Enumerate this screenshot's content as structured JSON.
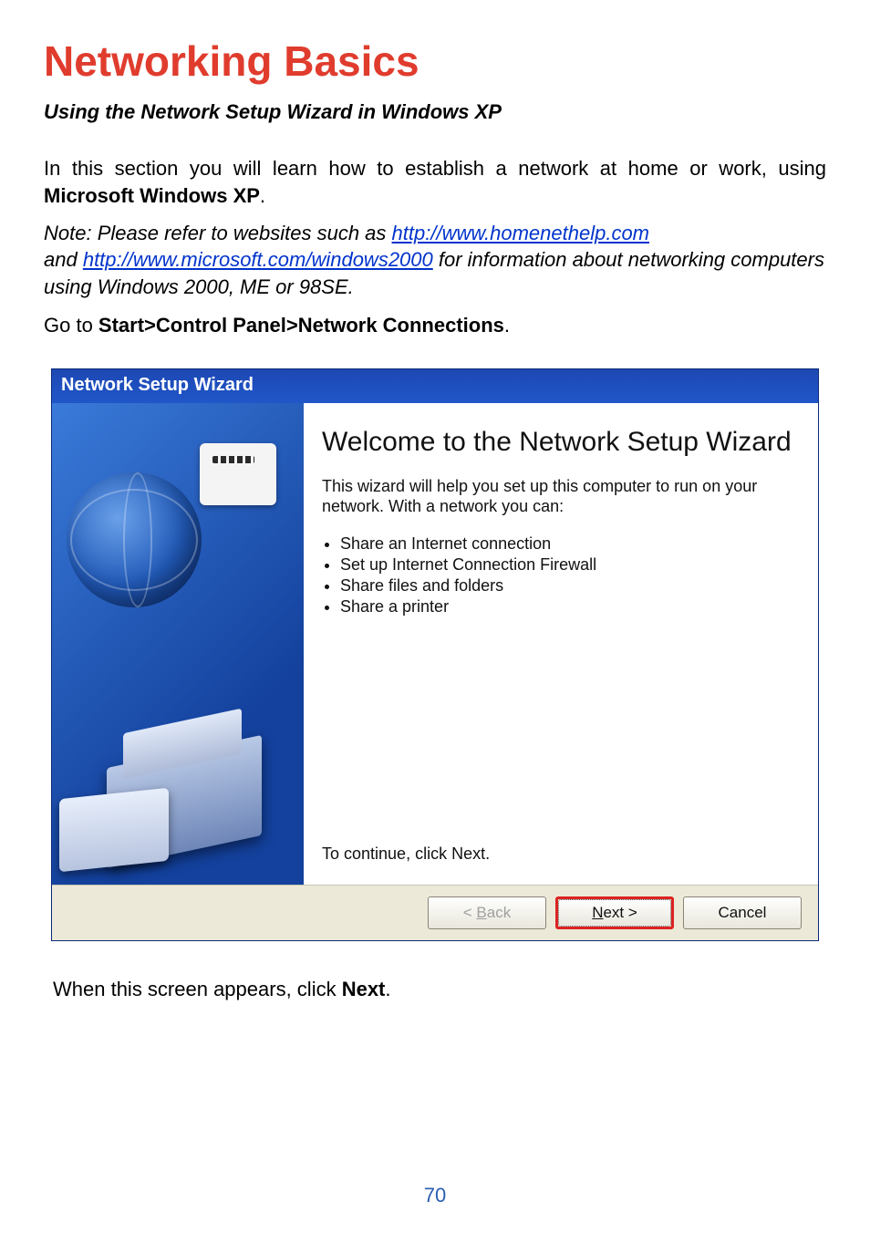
{
  "title": "Networking Basics",
  "subtitle": "Using the Network Setup Wizard in Windows XP",
  "para_intro": "In this section you will learn how to establish a network at home or work, using ",
  "para_intro_bold": "Microsoft Windows XP",
  "period": ".",
  "note": {
    "prefix": "Note:  Please refer to websites such as ",
    "link1_text": "http://www.homenethelp.com",
    "middle": "and ",
    "link2_text": "http://www.microsoft.com/windows2000",
    "suffix": "  for information about networking computers using Windows 2000, ME or 98SE."
  },
  "goto_prefix": "Go to ",
  "goto_bold": "Start>Control Panel>Network Connections",
  "wizard": {
    "title": "Network Setup Wizard",
    "heading": "Welcome to the Network Setup Wizard",
    "desc": "This wizard will help you set up this computer to run on your network. With a network you can:",
    "bullets": [
      "Share an Internet connection",
      "Set up Internet Connection Firewall",
      "Share files and folders",
      "Share a printer"
    ],
    "cont": "To continue, click Next.",
    "buttons": {
      "back_pre": "< ",
      "back_mn": "B",
      "back_post": "ack",
      "next_mn": "N",
      "next_post": "ext >",
      "cancel": "Cancel"
    }
  },
  "after_prefix": "When this screen appears, click ",
  "after_bold": "Next",
  "page_number": "70"
}
